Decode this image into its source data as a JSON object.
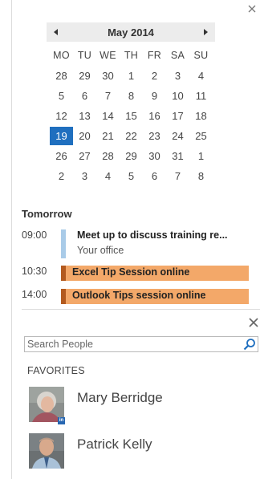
{
  "calendar": {
    "month_label": "May 2014",
    "prev_icon": "chevron-left-icon",
    "next_icon": "chevron-right-icon",
    "weekdays": [
      "MO",
      "TU",
      "WE",
      "TH",
      "FR",
      "SA",
      "SU"
    ],
    "weeks": [
      [
        "28",
        "29",
        "30",
        "1",
        "2",
        "3",
        "4"
      ],
      [
        "5",
        "6",
        "7",
        "8",
        "9",
        "10",
        "11"
      ],
      [
        "12",
        "13",
        "14",
        "15",
        "16",
        "17",
        "18"
      ],
      [
        "19",
        "20",
        "21",
        "22",
        "23",
        "24",
        "25"
      ],
      [
        "26",
        "27",
        "28",
        "29",
        "30",
        "31",
        "1"
      ],
      [
        "2",
        "3",
        "4",
        "5",
        "6",
        "7",
        "8"
      ]
    ],
    "today": "19",
    "today_color": "#1f6fbf"
  },
  "agenda": {
    "heading": "Tomorrow",
    "appointments": [
      {
        "time": "09:00",
        "title": "Meet up to discuss training re...",
        "location": "Your office",
        "color": "#a9cbe8"
      },
      {
        "time": "10:30",
        "title": "Excel Tip Session online",
        "color": "#f3a869"
      },
      {
        "time": "14:00",
        "title": "Outlook Tips session online",
        "color": "#f3a869"
      }
    ]
  },
  "people": {
    "search_placeholder": "Search People",
    "search_icon": "search-icon",
    "favorites_heading": "FAVORITES",
    "favorites": [
      {
        "name": "Mary Berridge",
        "badge": "in"
      },
      {
        "name": "Patrick Kelly"
      }
    ]
  },
  "icons": {
    "close_top": "close-icon",
    "close_people": "close-icon"
  }
}
